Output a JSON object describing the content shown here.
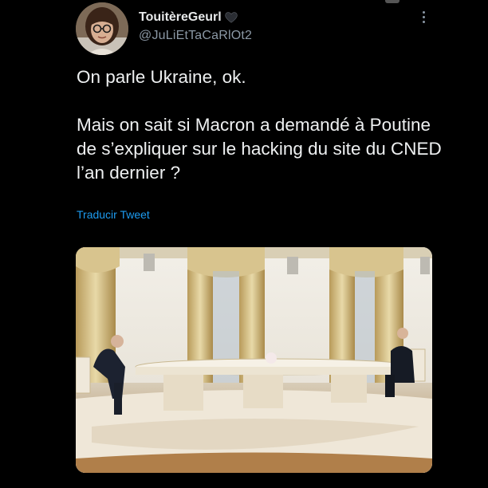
{
  "tweet": {
    "display_name": "TouitèreGeurl",
    "name_emoji_icon": "black-heart-icon",
    "handle": "@JuLiEtTaCaRlOt2",
    "paragraphs": [
      "On parle Ukraine, ok.",
      "Mais on sait si Macron a demandé à Poutine de s’expliquer sur le hacking du site du CNED l’an dernier ?"
    ],
    "translate_label": "Traducir Tweet",
    "more_icon": "more-vertical-icon"
  },
  "colors": {
    "background": "#000000",
    "text_primary": "#e7e9ea",
    "text_secondary": "#8b98a5",
    "link": "#1d9bf0"
  }
}
